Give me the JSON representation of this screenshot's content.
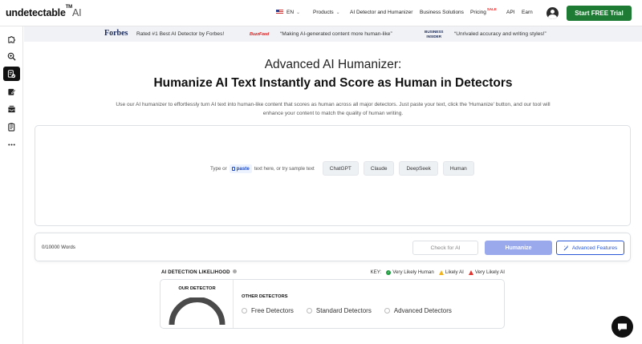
{
  "header": {
    "logo_text": "undetectable",
    "logo_tm": "TM",
    "logo_ai": "AI",
    "language": "EN",
    "nav": [
      {
        "label": "Products",
        "has_chevron": true
      },
      {
        "label": "AI Detector and Humanizer"
      },
      {
        "label": "Business Solutions"
      },
      {
        "label": "Pricing",
        "badge": "SALE"
      },
      {
        "label": "API"
      },
      {
        "label": "Earn"
      }
    ],
    "cta_label": "Start FREE Trial"
  },
  "sidebar": {
    "items": [
      {
        "icon": "puzzle-icon",
        "active": false
      },
      {
        "icon": "magnifier-icon",
        "active": false
      },
      {
        "icon": "document-check-icon",
        "active": true
      },
      {
        "icon": "edit-icon",
        "active": false
      },
      {
        "icon": "inbox-icon",
        "active": false
      },
      {
        "icon": "clipboard-list-icon",
        "active": false
      },
      {
        "icon": "more-icon",
        "active": false
      }
    ]
  },
  "banner": {
    "forbes_logo": "Forbes",
    "forbes_text": "Rated #1 Best AI Detector by Forbes!",
    "buzzfeed_logo": "BuzzFeed",
    "buzzfeed_text": "“Making AI-generated content more human-like”",
    "bi_logo_line1": "BUSINESS",
    "bi_logo_line2": "INSIDER",
    "bi_text": "“Unrivaled accuracy and writing styles!”"
  },
  "hero": {
    "title": "Advanced AI Humanizer:",
    "subtitle": "Humanize AI Text Instantly and Score as Human in Detectors",
    "description": "Use our AI humanizer to effortlessly turn AI text into human-like content that scores as human across all major detectors. Just paste your text, click the 'Humanize' button, and our tool will enhance your content to match the quality of human writing."
  },
  "editor": {
    "prompt_prefix": "Type or",
    "paste_label": "paste",
    "prompt_suffix": "text here, or try sample text",
    "samples": [
      "ChatGPT",
      "Claude",
      "DeepSeek",
      "Human"
    ]
  },
  "toolbar": {
    "word_count": "0/10000 Words",
    "check_label": "Check for AI",
    "humanize_label": "Humanize",
    "advanced_label": "Advanced Features"
  },
  "detection": {
    "title": "AI DETECTION LIKELIHOOD",
    "key_label": "KEY:",
    "key_items": [
      "Very Likely Human",
      "Likely AI",
      "Very Likely AI"
    ],
    "our_detector_title": "OUR DETECTOR",
    "other_detectors_title": "OTHER DETECTORS",
    "options": [
      "Free Detectors",
      "Standard Detectors",
      "Advanced Detectors"
    ]
  },
  "colors": {
    "cta_green": "#1e7b34",
    "humanize_button": "#9aa9ec",
    "accent_blue": "#2a58d6",
    "key_green": "#1e9a3e",
    "key_yellow": "#f2b418",
    "key_red": "#e3342f"
  }
}
